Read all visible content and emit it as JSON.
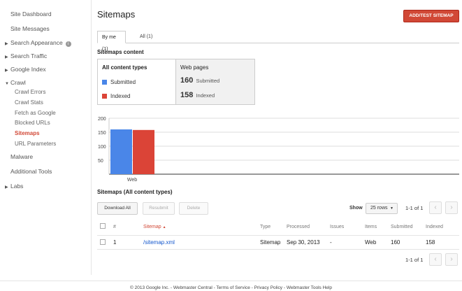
{
  "sidebar": {
    "items": [
      {
        "label": "Site Dashboard",
        "arrow": ""
      },
      {
        "label": "Site Messages",
        "arrow": ""
      },
      {
        "label": "Search Appearance",
        "arrow": "▶"
      },
      {
        "label": "Search Traffic",
        "arrow": "▶"
      },
      {
        "label": "Google Index",
        "arrow": "▶"
      },
      {
        "label": "Crawl",
        "arrow": "▼"
      },
      {
        "label": "Crawl Errors"
      },
      {
        "label": "Crawl Stats"
      },
      {
        "label": "Fetch as Google"
      },
      {
        "label": "Blocked URLs"
      },
      {
        "label": "Sitemaps"
      },
      {
        "label": "URL Parameters"
      },
      {
        "label": "Malware",
        "arrow": ""
      },
      {
        "label": "Additional Tools",
        "arrow": ""
      },
      {
        "label": "Labs",
        "arrow": "▶"
      }
    ],
    "info_icon": "i"
  },
  "header": {
    "title": "Sitemaps",
    "add_test_label": "ADD/TEST SITEMAP"
  },
  "tabs": [
    {
      "label": "By me (1)"
    },
    {
      "label": "All (1)"
    }
  ],
  "content_section": {
    "title": "Sitemaps content",
    "left_head": "All content types",
    "legend_submitted": "Submitted",
    "legend_indexed": "Indexed",
    "right_head": "Web pages",
    "submitted_value": "160",
    "submitted_label": "Submitted",
    "indexed_value": "158",
    "indexed_label": "Indexed"
  },
  "colors": {
    "submitted": "#4a86e8",
    "indexed": "#db4437",
    "accent": "#d14836"
  },
  "chart_data": {
    "type": "bar",
    "categories": [
      "Web"
    ],
    "series": [
      {
        "name": "Submitted",
        "values": [
          160
        ]
      },
      {
        "name": "Indexed",
        "values": [
          158
        ]
      }
    ],
    "yticks": [
      50,
      100,
      150,
      200
    ],
    "ylim": [
      0,
      200
    ],
    "grid": true,
    "legend": "none"
  },
  "table_section": {
    "title": "Sitemaps (All content types)",
    "download_all": "Download All",
    "resubmit": "Resubmit",
    "delete": "Delete",
    "show_label": "Show",
    "rows_value": "25 rows",
    "pager_text": "1-1 of 1",
    "prev_icon": "‹",
    "next_icon": "›"
  },
  "table": {
    "headers": {
      "num": "#",
      "sitemap": "Sitemap",
      "sort_icon": "▲",
      "type": "Type",
      "processed": "Processed",
      "issues": "Issues",
      "items": "Items",
      "submitted": "Submitted",
      "indexed": "Indexed"
    },
    "rows": [
      {
        "num": "1",
        "sitemap": "/sitemap.xml",
        "type": "Sitemap",
        "processed": "Sep 30, 2013",
        "issues": "-",
        "items": "Web",
        "submitted": "160",
        "indexed": "158"
      }
    ]
  },
  "footer": {
    "text": "© 2013 Google Inc. - Webmaster Central - Terms of Service - Privacy Policy - Webmaster Tools Help"
  }
}
